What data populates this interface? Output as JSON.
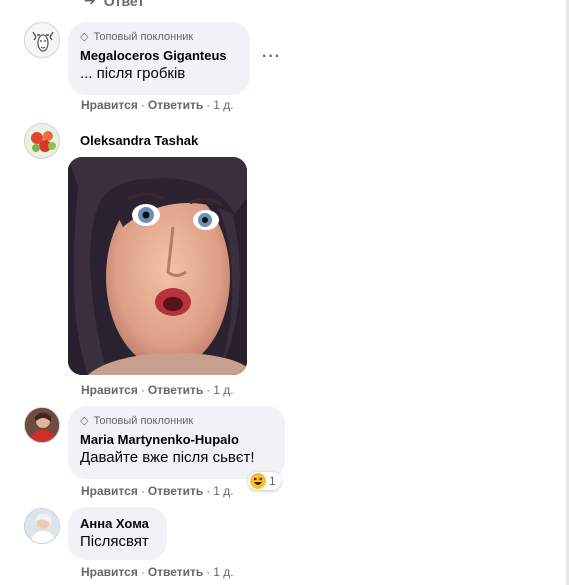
{
  "top_reply": {
    "label": "Ответ"
  },
  "common": {
    "like": "Нравится",
    "reply": "Ответить",
    "dot": "·"
  },
  "colors": {
    "bubble": "#f0f2f5",
    "meta": "#65676b",
    "text": "#050505"
  },
  "comments": [
    {
      "badge": "Топовый поклонник",
      "author": "Megaloceros Giganteus",
      "text": "... після гробків",
      "time": "1 д.",
      "avatar_icon": "moose-avatar"
    },
    {
      "author": "Oleksandra Tashak",
      "media": "gif-surprised-face",
      "time": "1 д.",
      "avatar_icon": "flowers-avatar"
    },
    {
      "badge": "Топовый поклонник",
      "author": "Maria Martynenko-Hupalo",
      "text": "Давайте вже після сьвєт!",
      "time": "1 д.",
      "reaction": {
        "icon": "haha-emoji",
        "count": "1"
      },
      "avatar_icon": "person-red-avatar"
    },
    {
      "author": "Анна Хома",
      "text": "Післясвят",
      "time": "1 д.",
      "avatar_icon": "person-white-avatar"
    }
  ]
}
